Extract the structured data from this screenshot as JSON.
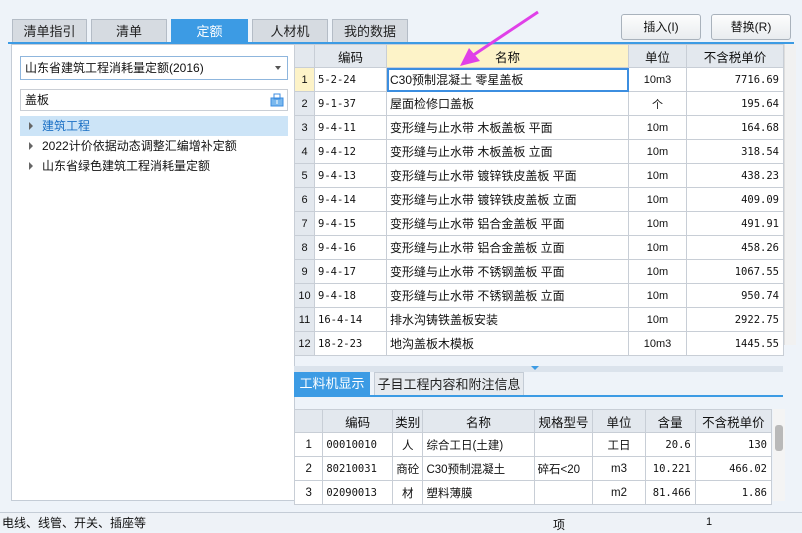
{
  "tabs": [
    {
      "label": "清单指引",
      "active": false
    },
    {
      "label": "清单",
      "active": false
    },
    {
      "label": "定额",
      "active": true
    },
    {
      "label": "人材机",
      "active": false
    },
    {
      "label": "我的数据",
      "active": false
    }
  ],
  "toolbar": {
    "insert_label": "插入(I)",
    "replace_label": "替换(R)"
  },
  "left_panel": {
    "library_select": "山东省建筑工程消耗量定额(2016)",
    "search_value": "盖板",
    "tree": [
      {
        "label": "建筑工程",
        "selected": true
      },
      {
        "label": "2022计价依据动态调整汇编增补定额",
        "selected": false
      },
      {
        "label": "山东省绿色建筑工程消耗量定额",
        "selected": false
      }
    ]
  },
  "main_grid": {
    "headers": {
      "code": "编码",
      "name": "名称",
      "unit": "单位",
      "price": "不含税单价"
    },
    "rows": [
      {
        "no": "1",
        "code": "5-2-24",
        "name": "C30预制混凝土 零星盖板",
        "unit": "10m3",
        "price": "7716.69"
      },
      {
        "no": "2",
        "code": "9-1-37",
        "name": "屋面检修口盖板",
        "unit": "个",
        "price": "195.64"
      },
      {
        "no": "3",
        "code": "9-4-11",
        "name": "变形缝与止水带 木板盖板 平面",
        "unit": "10m",
        "price": "164.68"
      },
      {
        "no": "4",
        "code": "9-4-12",
        "name": "变形缝与止水带 木板盖板 立面",
        "unit": "10m",
        "price": "318.54"
      },
      {
        "no": "5",
        "code": "9-4-13",
        "name": "变形缝与止水带 镀锌铁皮盖板 平面",
        "unit": "10m",
        "price": "438.23"
      },
      {
        "no": "6",
        "code": "9-4-14",
        "name": "变形缝与止水带 镀锌铁皮盖板 立面",
        "unit": "10m",
        "price": "409.09"
      },
      {
        "no": "7",
        "code": "9-4-15",
        "name": "变形缝与止水带 铝合金盖板 平面",
        "unit": "10m",
        "price": "491.91"
      },
      {
        "no": "8",
        "code": "9-4-16",
        "name": "变形缝与止水带 铝合金盖板 立面",
        "unit": "10m",
        "price": "458.26"
      },
      {
        "no": "9",
        "code": "9-4-17",
        "name": "变形缝与止水带 不锈钢盖板 平面",
        "unit": "10m",
        "price": "1067.55"
      },
      {
        "no": "10",
        "code": "9-4-18",
        "name": "变形缝与止水带 不锈钢盖板 立面",
        "unit": "10m",
        "price": "950.74"
      },
      {
        "no": "11",
        "code": "16-4-14",
        "name": "排水沟铸铁盖板安装",
        "unit": "10m",
        "price": "2922.75"
      },
      {
        "no": "12",
        "code": "18-2-23",
        "name": "地沟盖板木模板",
        "unit": "10m3",
        "price": "1445.55"
      }
    ]
  },
  "bottom_tabs": [
    {
      "label": "工料机显示",
      "active": true
    },
    {
      "label": "子目工程内容和附注信息",
      "active": false
    }
  ],
  "sub_grid": {
    "headers": {
      "code": "编码",
      "type": "类别",
      "name": "名称",
      "spec": "规格型号",
      "unit": "单位",
      "qty": "含量",
      "price": "不含税单价"
    },
    "rows": [
      {
        "no": "1",
        "code": "00010010",
        "type": "人",
        "name": "综合工日(土建)",
        "spec": "",
        "unit": "工日",
        "qty": "20.6",
        "price": "130"
      },
      {
        "no": "2",
        "code": "80210031",
        "type": "商砼",
        "name": "C30预制混凝土",
        "spec": "碎石<20",
        "unit": "m3",
        "qty": "10.221",
        "price": "466.02"
      },
      {
        "no": "3",
        "code": "02090013",
        "type": "材",
        "name": "塑料薄膜",
        "spec": "",
        "unit": "m2",
        "qty": "81.466",
        "price": "1.86"
      }
    ]
  },
  "background_row": {
    "text": "电线、线管、开关、插座等",
    "unit": "项",
    "qty": "1"
  },
  "colors": {
    "accent": "#3c9be4",
    "arrow": "#e040e8",
    "selected_header": "#fdf3c8"
  }
}
